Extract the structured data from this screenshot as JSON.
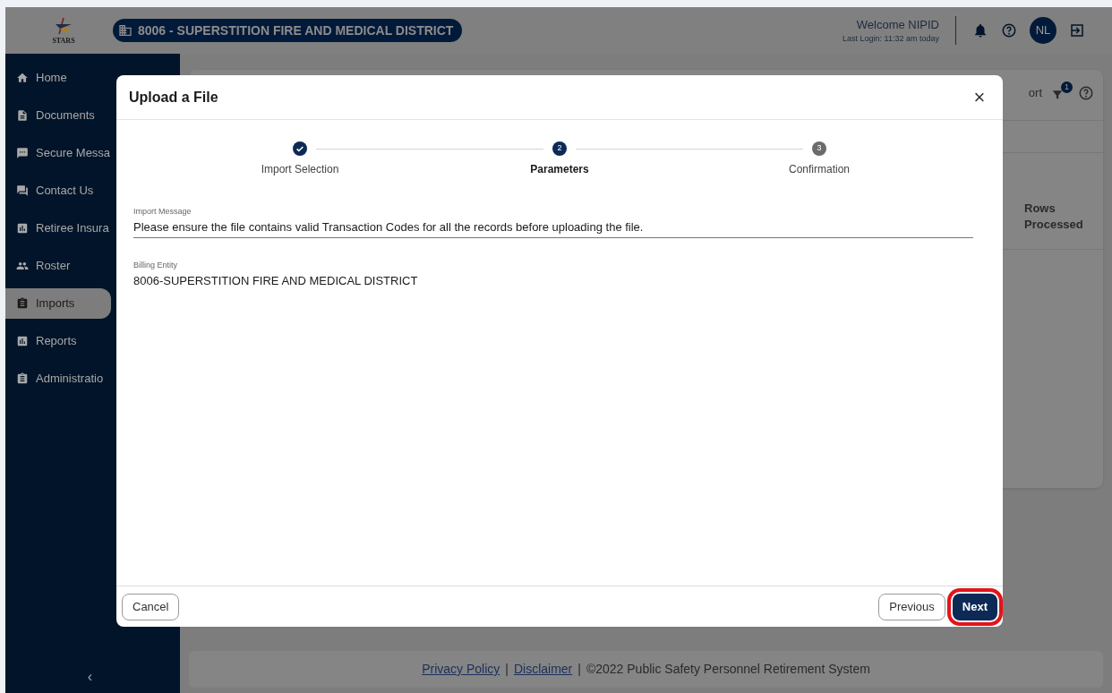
{
  "header": {
    "logo_text": "STARS",
    "entity": "8006 - SUPERSTITION FIRE AND MEDICAL DISTRICT",
    "welcome": "Welcome NIPID",
    "last_login": "Last Login: 11:32 am today",
    "avatar": "NL"
  },
  "sidebar": {
    "items": [
      {
        "label": "Home",
        "kind": "home",
        "selected": false
      },
      {
        "label": "Documents",
        "kind": "doc",
        "selected": false
      },
      {
        "label": "Secure Messa",
        "kind": "chat",
        "selected": false
      },
      {
        "label": "Contact Us",
        "kind": "forum",
        "selected": false
      },
      {
        "label": "Retiree Insura",
        "kind": "chart",
        "selected": false
      },
      {
        "label": "Roster",
        "kind": "people",
        "selected": false
      },
      {
        "label": "Imports",
        "kind": "clipboard",
        "selected": true
      },
      {
        "label": "Reports",
        "kind": "chart",
        "selected": false
      },
      {
        "label": "Administratio",
        "kind": "clipboard",
        "selected": false
      }
    ],
    "collapse": "‹"
  },
  "background_card": {
    "action": "ort",
    "filter_badge": "1",
    "column_header": "Rows Processed"
  },
  "footer": {
    "parts": [
      {
        "text": "Privacy Policy",
        "kind": "link"
      },
      {
        "text": "|",
        "kind": "text"
      },
      {
        "text": "Disclaimer",
        "kind": "link"
      },
      {
        "text": "|",
        "kind": "text"
      },
      {
        "text": "©2022 Public Safety Personnel Retirement System",
        "kind": "text"
      }
    ]
  },
  "modal": {
    "title": "Upload a File",
    "close": "×",
    "steps": [
      {
        "label": "Import Selection",
        "completed": true,
        "selected": false
      },
      {
        "label": "Parameters",
        "number": "2",
        "completed": false,
        "selected": true
      },
      {
        "label": "Confirmation",
        "number": "3",
        "completed": false,
        "selected": false
      }
    ],
    "fields": [
      {
        "label": "Import Message",
        "value": "Please ensure the file contains valid Transaction Codes for all the records before uploading the file.",
        "kind": "underlined"
      },
      {
        "label": "Billing Entity",
        "value": "8006-SUPERSTITION FIRE AND MEDICAL DISTRICT",
        "kind": "plain"
      }
    ],
    "buttons": [
      {
        "label": "Cancel",
        "kind": "outline",
        "highlighted": false
      },
      {
        "label": "Previous",
        "kind": "outline",
        "highlighted": false
      },
      {
        "label": "Next",
        "kind": "primary",
        "highlighted": true
      }
    ]
  }
}
